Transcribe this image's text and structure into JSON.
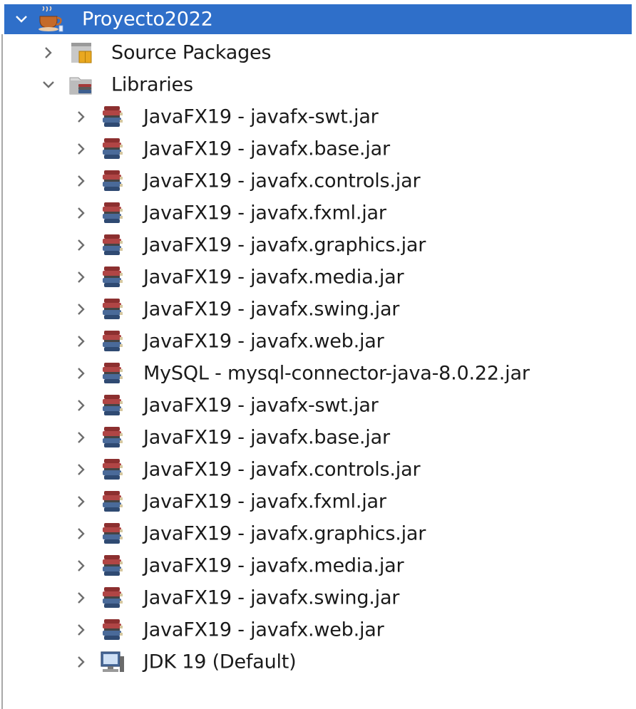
{
  "tree": {
    "root": {
      "label": "Proyecto2022",
      "icon": "java-project-icon",
      "expanded": true,
      "selected": true
    },
    "source_packages": {
      "label": "Source Packages",
      "icon": "package-folder-icon",
      "expanded": false
    },
    "libraries": {
      "label": "Libraries",
      "icon": "libraries-folder-icon",
      "expanded": true,
      "items": [
        {
          "label": "JavaFX19 - javafx-swt.jar",
          "icon": "jar-library-icon"
        },
        {
          "label": "JavaFX19 - javafx.base.jar",
          "icon": "jar-library-icon"
        },
        {
          "label": "JavaFX19 - javafx.controls.jar",
          "icon": "jar-library-icon"
        },
        {
          "label": "JavaFX19 - javafx.fxml.jar",
          "icon": "jar-library-icon"
        },
        {
          "label": "JavaFX19 - javafx.graphics.jar",
          "icon": "jar-library-icon"
        },
        {
          "label": "JavaFX19 - javafx.media.jar",
          "icon": "jar-library-icon"
        },
        {
          "label": "JavaFX19 - javafx.swing.jar",
          "icon": "jar-library-icon"
        },
        {
          "label": "JavaFX19 - javafx.web.jar",
          "icon": "jar-library-icon"
        },
        {
          "label": "MySQL - mysql-connector-java-8.0.22.jar",
          "icon": "jar-library-icon"
        },
        {
          "label": "JavaFX19 - javafx-swt.jar",
          "icon": "jar-library-icon"
        },
        {
          "label": "JavaFX19 - javafx.base.jar",
          "icon": "jar-library-icon"
        },
        {
          "label": "JavaFX19 - javafx.controls.jar",
          "icon": "jar-library-icon"
        },
        {
          "label": "JavaFX19 - javafx.fxml.jar",
          "icon": "jar-library-icon"
        },
        {
          "label": "JavaFX19 - javafx.graphics.jar",
          "icon": "jar-library-icon"
        },
        {
          "label": "JavaFX19 - javafx.media.jar",
          "icon": "jar-library-icon"
        },
        {
          "label": "JavaFX19 - javafx.swing.jar",
          "icon": "jar-library-icon"
        },
        {
          "label": "JavaFX19 - javafx.web.jar",
          "icon": "jar-library-icon"
        },
        {
          "label": "JDK 19 (Default)",
          "icon": "jdk-platform-icon"
        }
      ]
    }
  },
  "colors": {
    "selection": "#2f6fc9",
    "selected_text": "#ffffff",
    "text": "#1a1a1a",
    "chevron": "#6e6e6e",
    "jar_red": "#a33a3a",
    "jar_blue": "#3e5f8f"
  }
}
